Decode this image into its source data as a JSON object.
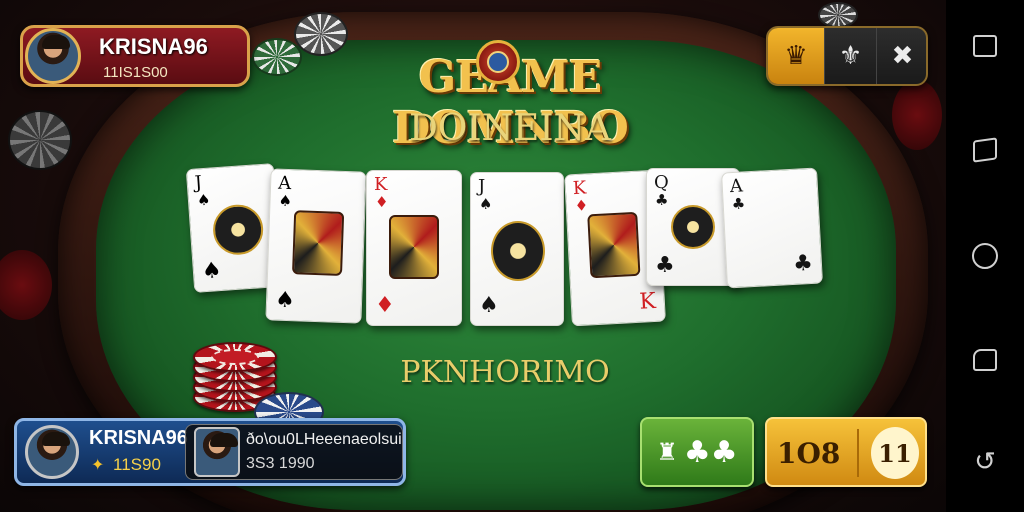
{
  "game": {
    "title": "GEAME DOMNBO",
    "subtitle": "DOINEINA",
    "promo": "PKNHORIMO"
  },
  "player_badge": {
    "name": "KRISNA96",
    "score": "11IS1S00"
  },
  "top_actions": {
    "buttons": [
      {
        "icon": "crown-icon",
        "glyph": "♛"
      },
      {
        "icon": "emblem-icon",
        "glyph": "⚜"
      },
      {
        "icon": "crossed-tools-icon",
        "glyph": "✖"
      }
    ]
  },
  "cards": [
    {
      "rank": "J",
      "suit": "♠",
      "color": "black"
    },
    {
      "rank": "A",
      "suit": "♠",
      "color": "black"
    },
    {
      "rank": "K",
      "suit": "♦",
      "color": "red"
    },
    {
      "rank": "J",
      "suit": "♠",
      "color": "black"
    },
    {
      "rank": "K",
      "suit": "♦",
      "color": "red"
    },
    {
      "rank": "Q",
      "suit": "♣",
      "color": "black"
    },
    {
      "rank": "A",
      "suit": "♣",
      "color": "black"
    }
  ],
  "seat": {
    "name": "KRISNA96",
    "coins": "11S90"
  },
  "opponent": {
    "name": "ðo\\ou0LHeeenaeolsui",
    "coins": "3S3 1990"
  },
  "actions": {
    "green_glyph": "♣",
    "gold_value": "1O8",
    "gold_icon_text": "11"
  },
  "colors": {
    "felt": "#1f6e2d",
    "rail": "#3b1b12",
    "badge_red": "#8e1a22",
    "seat_blue": "#1f4f8e",
    "gold": "#f2b52c",
    "green_button": "#4f9a2a"
  }
}
